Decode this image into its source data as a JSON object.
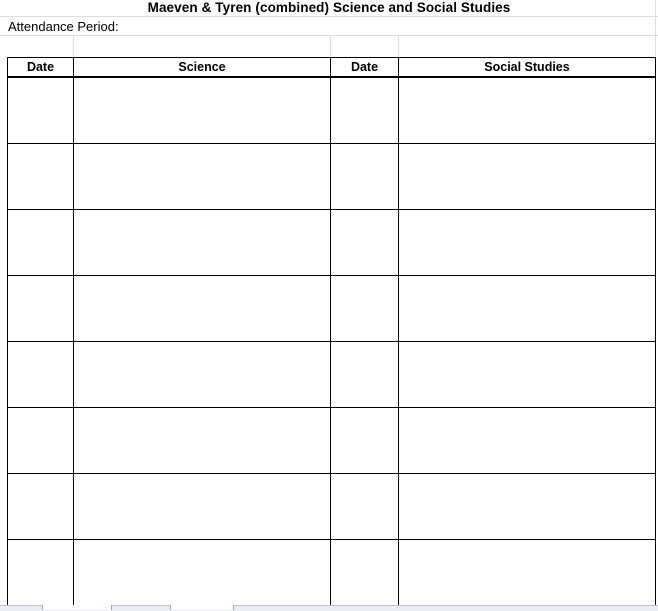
{
  "document": {
    "title": "Maeven & Tyren (combined) Science and Social Studies",
    "attendance_label": "Attendance Period:"
  },
  "table": {
    "headers": [
      "Date",
      "Science",
      "Date",
      "Social Studies"
    ],
    "row_count": 8
  }
}
